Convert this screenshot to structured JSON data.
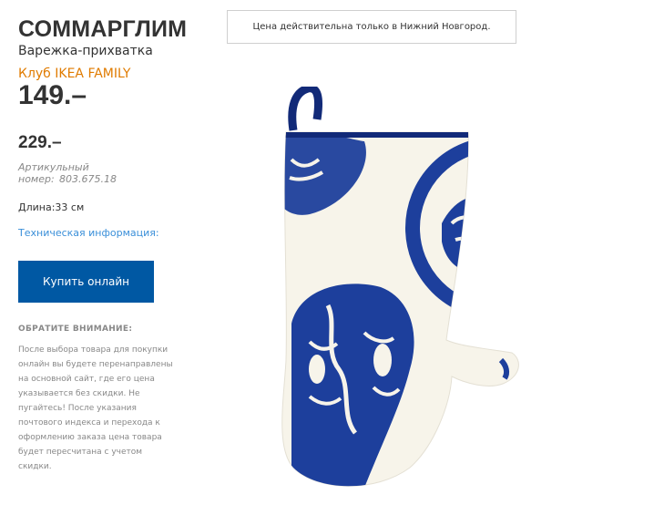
{
  "product": {
    "name": "СОММАРГЛИМ",
    "type": "Варежка-прихватка",
    "family_label": "Клуб IKEA FAMILY",
    "family_price": "149.–",
    "regular_price": "229.–",
    "article_label": "Артикульный номер:",
    "article_number": "803.675.18",
    "length": "Длина:33 см",
    "tech_info_link": "Техническая информация:",
    "buy_button": "Купить онлайн"
  },
  "notice": {
    "heading": "ОБРАТИТЕ ВНИМАНИЕ:",
    "lines": [
      "После выбора товара для покупки",
      "онлайн вы будете перенаправлены",
      "на основной сайт, где его цена",
      "указывается без скидки. Не",
      "пугайтесь! После указания",
      "почтового индекса и перехода к",
      "оформлению заказа цена товара",
      "будет пересчитана с учетом",
      "скидки."
    ]
  },
  "banner": {
    "text": "Цена действительна только в Нижний Новгород."
  },
  "colors": {
    "accent_blue": "#0058a3",
    "family_orange": "#e07b00",
    "link_blue": "#3a8fd9",
    "print_blue": "#1d3f9c"
  }
}
